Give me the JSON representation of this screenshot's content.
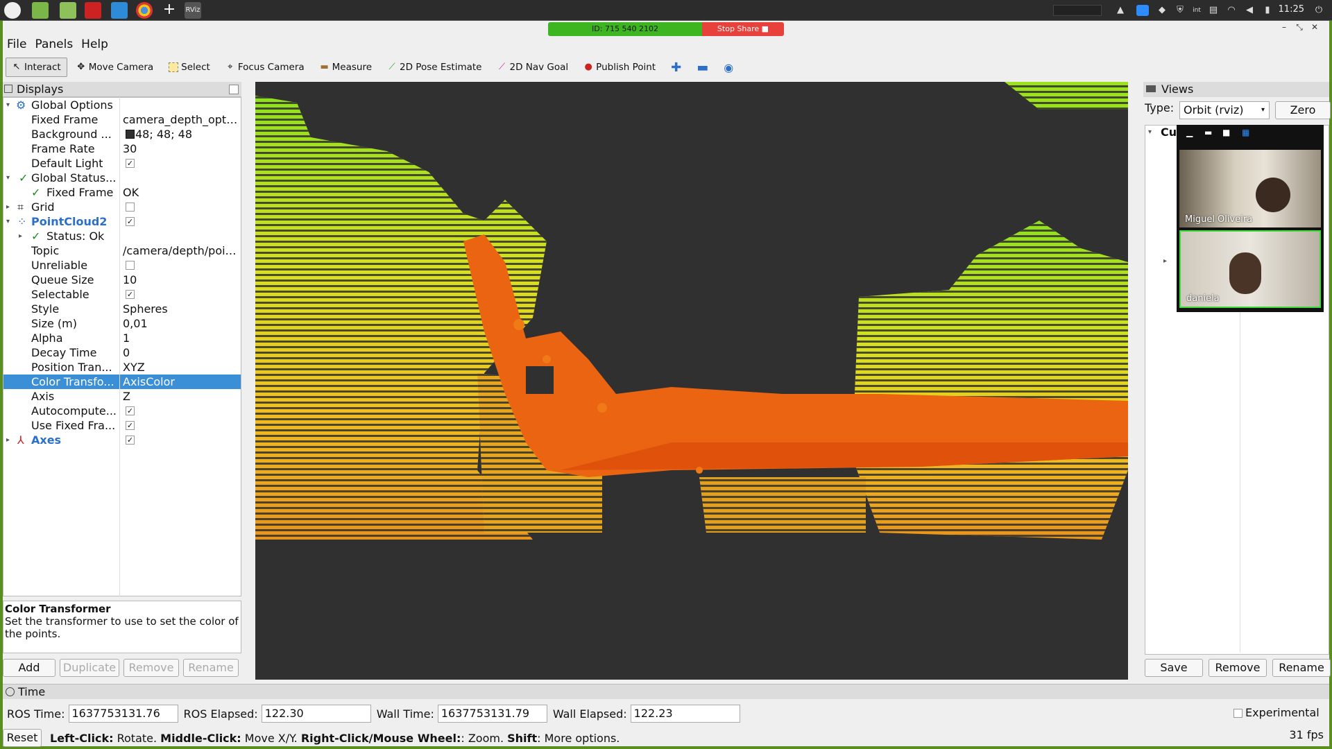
{
  "os": {
    "clock": "11:25",
    "launcher_icons": [
      "mint-menu-icon",
      "desktop-icon",
      "files-icon",
      "terminal-icon",
      "editor-icon",
      "chrome-icon",
      "add-icon",
      "rviz-icon"
    ],
    "tray_icons": [
      "network-icon",
      "zoom-icon",
      "dropbox-icon",
      "shield-icon",
      "intel-icon",
      "printer-icon",
      "wifi-icon",
      "volume-icon",
      "battery-icon"
    ]
  },
  "share": {
    "id_text": "ID: 715 540 2102",
    "stop_label": "Stop Share"
  },
  "menu": [
    "File",
    "Panels",
    "Help"
  ],
  "toolbar": {
    "tools": [
      {
        "label": "Interact",
        "icon": "cursor-icon",
        "active": true
      },
      {
        "label": "Move Camera",
        "icon": "move-icon",
        "active": false
      },
      {
        "label": "Select",
        "icon": "select-icon",
        "active": false
      },
      {
        "label": "Focus Camera",
        "icon": "focus-icon",
        "active": false
      },
      {
        "label": "Measure",
        "icon": "ruler-icon",
        "active": false
      },
      {
        "label": "2D Pose Estimate",
        "icon": "arrow-green-icon",
        "active": false
      },
      {
        "label": "2D Nav Goal",
        "icon": "arrow-pink-icon",
        "active": false
      },
      {
        "label": "Publish Point",
        "icon": "pin-icon",
        "active": false
      }
    ]
  },
  "displays": {
    "title": "Displays",
    "rows": [
      {
        "label": "Global Options",
        "value": ""
      },
      {
        "label": "Fixed Frame",
        "value": "camera_depth_opt…"
      },
      {
        "label": "Background ...",
        "value": "48; 48; 48"
      },
      {
        "label": "Frame Rate",
        "value": "30"
      },
      {
        "label": "Default Light",
        "value": ""
      },
      {
        "label": "Global Status...",
        "value": ""
      },
      {
        "label": "Fixed Frame",
        "value": "OK"
      },
      {
        "label": "Grid",
        "value": ""
      },
      {
        "label": "PointCloud2",
        "value": ""
      },
      {
        "label": "Status: Ok",
        "value": ""
      },
      {
        "label": "Topic",
        "value": "/camera/depth/poi…"
      },
      {
        "label": "Unreliable",
        "value": ""
      },
      {
        "label": "Queue Size",
        "value": "10"
      },
      {
        "label": "Selectable",
        "value": ""
      },
      {
        "label": "Style",
        "value": "Spheres"
      },
      {
        "label": "Size (m)",
        "value": "0,01"
      },
      {
        "label": "Alpha",
        "value": "1"
      },
      {
        "label": "Decay Time",
        "value": "0"
      },
      {
        "label": "Position Tran...",
        "value": "XYZ"
      },
      {
        "label": "Color Transfo...",
        "value": "AxisColor"
      },
      {
        "label": "Axis",
        "value": "Z"
      },
      {
        "label": "Autocompute...",
        "value": ""
      },
      {
        "label": "Use Fixed Fra...",
        "value": ""
      },
      {
        "label": "Axes",
        "value": ""
      }
    ],
    "description_title": "Color Transformer",
    "description_text": "Set the transformer to use to set the color of the points.",
    "buttons": [
      "Add",
      "Duplicate",
      "Remove",
      "Rename"
    ],
    "background_swatch": "#303030"
  },
  "views": {
    "title": "Views",
    "type_label": "Type:",
    "type_value": "Orbit (rviz)",
    "zero_label": "Zero",
    "current_label": "Cu",
    "buttons": [
      "Save",
      "Remove",
      "Rename"
    ]
  },
  "zoom": {
    "participants": [
      "Miguel Oliveira",
      "daniela"
    ]
  },
  "time": {
    "title": "Time",
    "ros_time_label": "ROS Time:",
    "ros_time": "1637753131.76",
    "ros_elapsed_label": "ROS Elapsed:",
    "ros_elapsed": "122.30",
    "wall_time_label": "Wall Time:",
    "wall_time": "1637753131.79",
    "wall_elapsed_label": "Wall Elapsed:",
    "wall_elapsed": "122.23",
    "experimental_label": "Experimental"
  },
  "status": {
    "reset_label": "Reset",
    "parts": [
      {
        "text": "Left-Click:",
        "bold": true
      },
      {
        "text": " Rotate. ",
        "bold": false
      },
      {
        "text": "Middle-Click:",
        "bold": true
      },
      {
        "text": " Move X/Y. ",
        "bold": false
      },
      {
        "text": "Right-Click/Mouse Wheel:",
        "bold": true
      },
      {
        "text": ": Zoom. ",
        "bold": false
      },
      {
        "text": "Shift",
        "bold": true
      },
      {
        "text": ": More options.",
        "bold": false
      }
    ],
    "fps": "31 fps"
  },
  "colors": {
    "accent": "#3a8fd6",
    "window_border": "#5a8e1f",
    "viewport_bg": "#303030"
  }
}
